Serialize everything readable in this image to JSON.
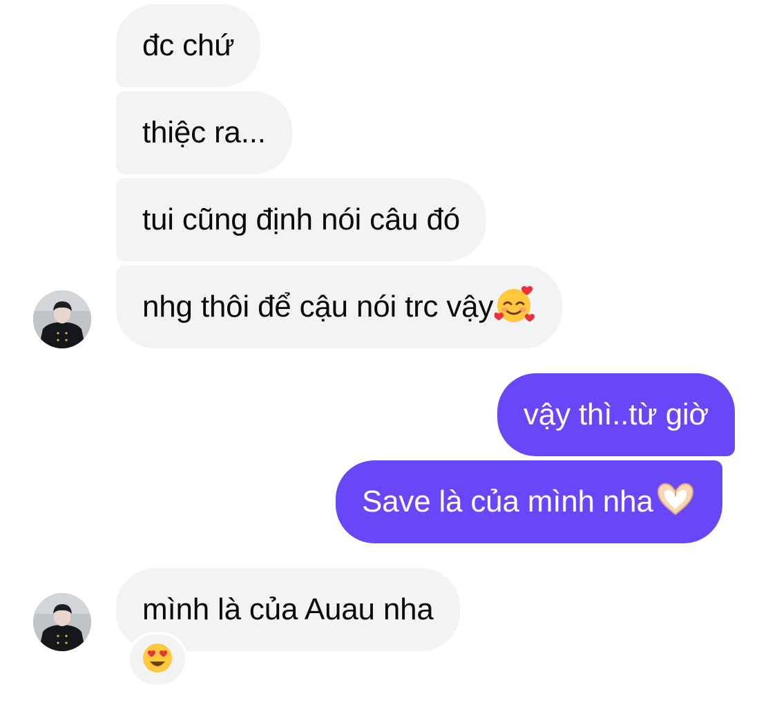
{
  "conversation": {
    "messages": [
      {
        "sender": "them",
        "text": "đc chứ"
      },
      {
        "sender": "them",
        "text": "thiệc ra..."
      },
      {
        "sender": "them",
        "text": "tui cũng định nói câu đó"
      },
      {
        "sender": "them",
        "text": "nhg thôi để cậu nói trc vậy",
        "emoji": "smiling-face-with-hearts"
      },
      {
        "sender": "me",
        "text": "vậy thì..từ giờ"
      },
      {
        "sender": "me",
        "text": "Save là của mình nha",
        "emoji": "heart-hands"
      },
      {
        "sender": "them",
        "text": "mình là của Auau nha",
        "reaction": "heart-eyes"
      }
    ]
  },
  "colors": {
    "incoming_bubble": "#f2f3f5",
    "outgoing_bubble": "#6847f8",
    "incoming_text": "#0a0a0a",
    "outgoing_text": "#ffffff"
  },
  "icons": {
    "avatar": "contact-avatar-photo",
    "emoji_1": "smiling-face-with-hearts",
    "emoji_2": "heart-hands",
    "reaction": "heart-eyes"
  }
}
